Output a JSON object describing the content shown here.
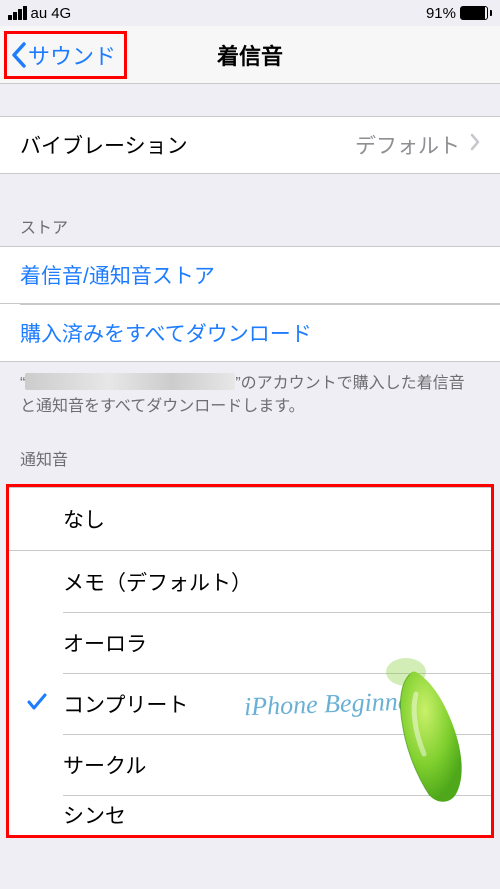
{
  "status": {
    "carrier": "au",
    "network": "4G",
    "battery_pct": "91%"
  },
  "nav": {
    "back_label": "サウンド",
    "title": "着信音"
  },
  "vibration": {
    "label": "バイブレーション",
    "value": "デフォルト"
  },
  "store": {
    "header": "ストア",
    "ringtone_store": "着信音/通知音ストア",
    "download_all": "購入済みをすべてダウンロード",
    "footer_quote_open": "“",
    "footer_suffix": "”のアカウントで購入した着信音と通知音をすべてダウンロードします。"
  },
  "alerts": {
    "header": "通知音",
    "items": [
      {
        "label": "なし",
        "selected": false
      },
      {
        "label": "メモ（デフォルト）",
        "selected": false
      },
      {
        "label": "オーロラ",
        "selected": false
      },
      {
        "label": "コンプリート",
        "selected": true
      },
      {
        "label": "サークル",
        "selected": false
      },
      {
        "label": "シンセ",
        "selected": false
      }
    ]
  },
  "watermark": "iPhone Beginners"
}
